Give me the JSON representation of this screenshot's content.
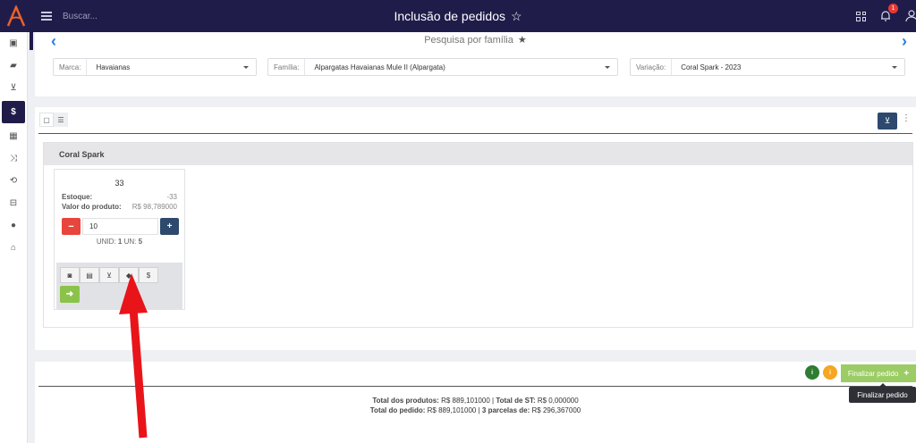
{
  "app": {
    "title": "Inclusão de pedidos",
    "search_placeholder": "Buscar...",
    "notification_count": "1"
  },
  "filter": {
    "title": "Pesquisa por família",
    "marca_label": "Marca:",
    "marca_value": "Havaianas",
    "familia_label": "Família:",
    "familia_value": "Alpargatas Havaianas Mule II (Alpargata)",
    "variacao_label": "Variação:",
    "variacao_value": "Coral Spark - 2023"
  },
  "group": {
    "title": "Coral Spark"
  },
  "card": {
    "size": "33",
    "estoque_label": "Estoque:",
    "estoque_value": "-33",
    "valor_label": "Valor do produto:",
    "valor_value": "R$ 98,789000",
    "quantity": "10",
    "unid_label": "UNID:",
    "unid_value": "1",
    "un_label": "UN:",
    "un_value": "5"
  },
  "footer": {
    "finalize_label": "Finalizar pedido",
    "tooltip": "Finalizar pedido",
    "total_produtos_label": "Total dos produtos:",
    "total_produtos_value": "R$ 889,101000",
    "total_st_label": "Total de ST:",
    "total_st_value": "R$ 0,000000",
    "total_pedido_label": "Total do pedido:",
    "total_pedido_value": "R$ 889,101000",
    "parcelas_label": "3 parcelas de:",
    "parcelas_value": "R$ 296,367000"
  },
  "colors": {
    "topbar": "#201c4a",
    "accent_blue": "#2a7de1",
    "danger": "#e8453c",
    "primary_dark": "#2d4a6e",
    "success": "#8bc34a",
    "annotation_arrow": "#e8141a"
  },
  "icons": {
    "sidebar": [
      "money-icon",
      "briefcase-icon",
      "cart-icon",
      "dollar-icon",
      "table-icon",
      "shuffle-icon",
      "retweet-icon",
      "basket-icon",
      "user-icon",
      "home-icon"
    ],
    "card_actions": [
      "camera-icon",
      "table-icon",
      "cart-icon",
      "tag-icon",
      "dollar-icon"
    ]
  }
}
